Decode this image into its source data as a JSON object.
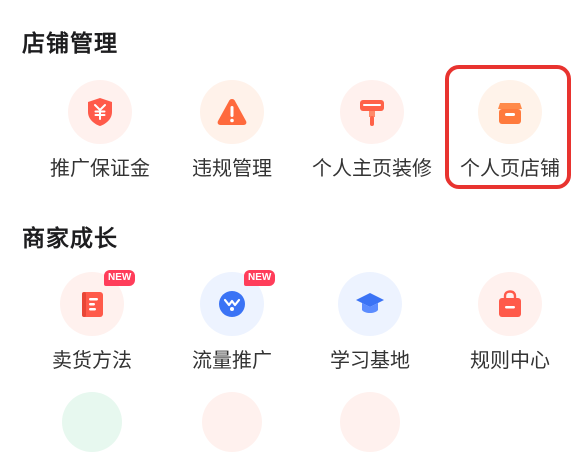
{
  "sections": [
    {
      "title": "店铺管理",
      "items": [
        {
          "label": "推广保证金",
          "icon": "shield-yen-icon",
          "color": "#ff5a4a",
          "bg": "#fff1ee"
        },
        {
          "label": "违规管理",
          "icon": "warning-icon",
          "color": "#ff6a3d",
          "bg": "#fff2ea"
        },
        {
          "label": "个人主页装修",
          "icon": "paint-roller-icon",
          "color": "#ff6248",
          "bg": "#fff1ee"
        },
        {
          "label": "个人页店铺",
          "icon": "shop-box-icon",
          "color": "#ff7a3d",
          "bg": "#fff3ea",
          "highlighted": true
        }
      ]
    },
    {
      "title": "商家成长",
      "items": [
        {
          "label": "卖货方法",
          "icon": "book-icon",
          "color": "#ff5a4a",
          "bg": "#fff1ee",
          "badge": "NEW"
        },
        {
          "label": "流量推广",
          "icon": "traffic-icon",
          "color": "#3b73f5",
          "bg": "#edf3ff",
          "badge": "NEW"
        },
        {
          "label": "学习基地",
          "icon": "graduation-cap-icon",
          "color": "#3b73f5",
          "bg": "#edf3ff"
        },
        {
          "label": "规则中心",
          "icon": "bag-icon",
          "color": "#ff5a4a",
          "bg": "#fff1ee"
        }
      ]
    }
  ],
  "peek_colors": [
    "#e7f8ef",
    "#fff1ee",
    "#fff1ee"
  ]
}
